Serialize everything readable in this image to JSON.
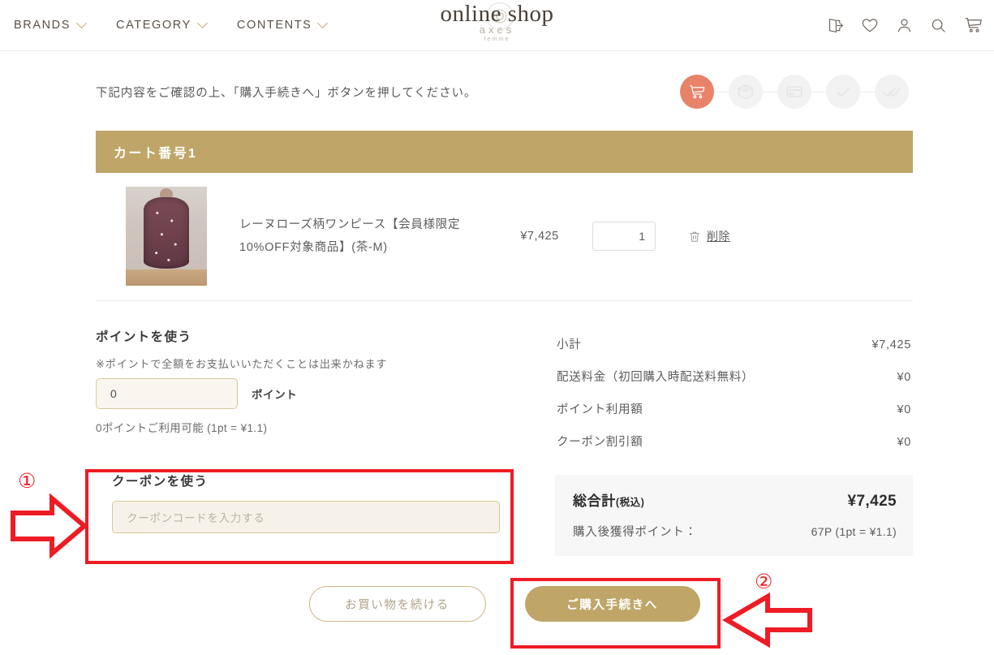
{
  "header": {
    "nav": [
      {
        "label": "BRANDS",
        "icon": "chevron-down-icon"
      },
      {
        "label": "CATEGORY",
        "icon": "chevron-down-icon"
      },
      {
        "label": "CONTENTS",
        "icon": "chevron-down-icon"
      }
    ],
    "logo": {
      "main": "online shop",
      "sub": "axes",
      "sub2": "femme",
      "emblem": "rose-icon"
    },
    "icons": [
      {
        "name": "logout-icon"
      },
      {
        "name": "heart-icon"
      },
      {
        "name": "account-icon"
      },
      {
        "name": "search-icon"
      },
      {
        "name": "cart-icon"
      }
    ]
  },
  "intro": {
    "text": "下記内容をご確認の上、「購入手続きへ」ボタンを押してください。"
  },
  "steps": [
    {
      "name": "cart-step",
      "state": "active"
    },
    {
      "name": "delivery-step",
      "state": "inactive"
    },
    {
      "name": "payment-step",
      "state": "inactive"
    },
    {
      "name": "confirm-step",
      "state": "inactive"
    },
    {
      "name": "complete-step",
      "state": "inactive"
    }
  ],
  "cart": {
    "title": "カート番号1",
    "item": {
      "name": "レーヌローズ柄ワンピース【会員様限定10%OFF対象商品】(茶-M)",
      "price": "¥7,425",
      "quantity": "1",
      "delete_label": "削除",
      "delete_icon": "trash-icon"
    }
  },
  "points": {
    "title": "ポイントを使う",
    "note": "※ポイントで全額をお支払いいただくことは出来かねます",
    "input_value": "0",
    "unit": "ポイント",
    "available": "0ポイントご利用可能 (1pt = ¥1.1)"
  },
  "coupon": {
    "title": "クーポンを使う",
    "placeholder": "クーポンコードを入力する",
    "input_value": ""
  },
  "summary": {
    "rows": [
      {
        "label": "小計",
        "value": "¥7,425"
      },
      {
        "label": "配送料金（初回購入時配送料無料）",
        "value": "¥0"
      },
      {
        "label": "ポイント利用額",
        "value": "¥0"
      },
      {
        "label": "クーポン割引額",
        "value": "¥0"
      }
    ],
    "total_label": "総合計",
    "total_label_sub": "(税込)",
    "total_value": "¥7,425",
    "earn_label": "購入後獲得ポイント：",
    "earn_value": "67P (1pt = ¥1.1)"
  },
  "buttons": {
    "continue_shopping": "お買い物を続ける",
    "checkout": "ご購入手続きへ"
  },
  "annotations": [
    {
      "number": "①",
      "target": "coupon-section"
    },
    {
      "number": "②",
      "target": "checkout-button"
    }
  ],
  "colors": {
    "gold": "#bfa668",
    "active_step": "#e8836a",
    "annotation_red": "#ee1c25",
    "input_cream": "#f7f2e9"
  }
}
